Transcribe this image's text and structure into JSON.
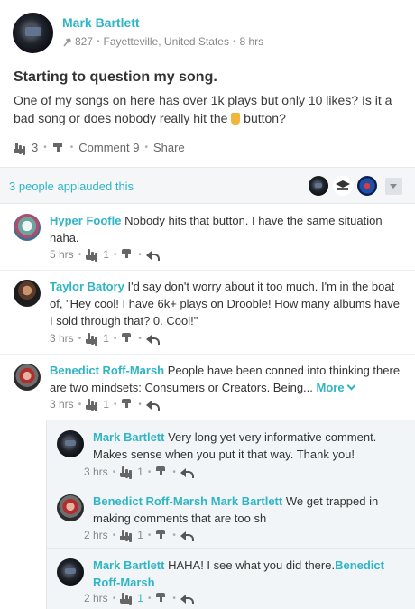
{
  "post": {
    "author": "Mark Bartlett",
    "icon": "guitar-headstock-icon",
    "followers": "827",
    "location": "Fayetteville, United States",
    "time": "8 hrs",
    "title": "Starting to question my song.",
    "body_before": "One of my songs on here has over 1k plays but only 10 likes? Is it a bad song or does nobody really hit the",
    "body_after": "button?",
    "applause_count": "3",
    "comment_label": "Comment",
    "comment_count": "9",
    "share_label": "Share"
  },
  "applause_bar": {
    "text": "3 people applauded this"
  },
  "comments": [
    {
      "author": "Hyper Foofle",
      "text": "Nobody hits that button. I have the same situation haha.",
      "time": "5 hrs",
      "applause": "1"
    },
    {
      "author": "Taylor Batory",
      "text": "I'd say don't worry about it too much. I'm in the boat of, \"Hey cool! I have 6k+ plays on Drooble! How many albums have I sold through that? 0. Cool!\"",
      "time": "3 hrs",
      "applause": "1"
    },
    {
      "author": "Benedict Roff-Marsh",
      "text": "People have been conned into thinking there are two mindsets: Consumers or Creators. Being...",
      "more": "More",
      "time": "3 hrs",
      "applause": "1"
    }
  ],
  "replies": [
    {
      "author": "Mark Bartlett",
      "text": "Very long yet very informative comment. Makes sense when you put it that way. Thank you!",
      "time": "3 hrs",
      "applause": "1"
    },
    {
      "author": "Benedict Roff-Marsh",
      "mention": "Mark Bartlett",
      "text": "We get trapped in making comments that are too sh",
      "time": "2 hrs",
      "applause": "1"
    },
    {
      "author": "Mark Bartlett",
      "text": "HAHA! I see what you did there.",
      "mention": "Benedict Roff-Marsh",
      "time": "2 hrs",
      "applause": "1"
    }
  ],
  "colors": {
    "accent": "#2fb5c5",
    "rock_hand": "#f0b63a"
  }
}
